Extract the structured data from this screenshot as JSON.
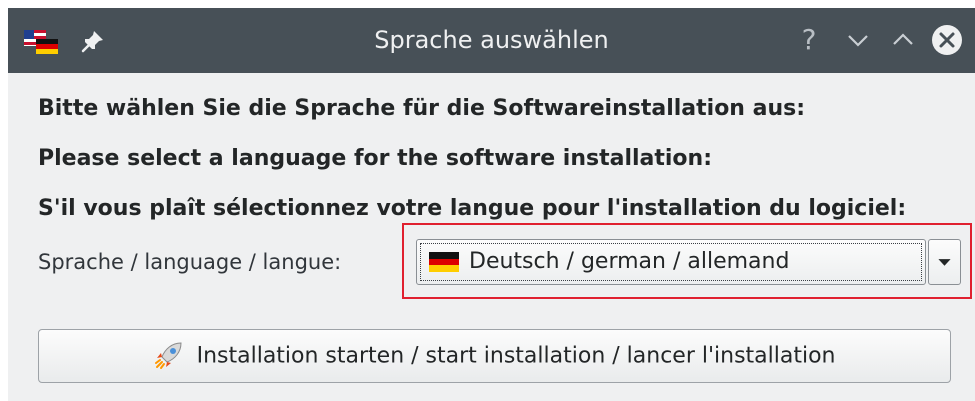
{
  "window": {
    "title": "Sprache auswählen",
    "help_glyph": "?",
    "icons": [
      "language-flags-icon",
      "pin-icon",
      "help-icon",
      "minimize-icon",
      "maximize-icon",
      "close-icon"
    ]
  },
  "prompt": {
    "de": "Bitte wählen Sie die Sprache für die Softwareinstallation aus:",
    "en": "Please select a language for the software installation:",
    "fr": "S'il vous plaît sélectionnez votre langue pour l'installation du logiciel:"
  },
  "language_select": {
    "label": "Sprache / language / langue:",
    "selected": "Deutsch / german / allemand",
    "selected_flag": "german-flag-icon"
  },
  "start_button": {
    "label": "Installation starten / start installation / lancer l'installation",
    "icon": "rocket-icon"
  },
  "colors": {
    "titlebar": "#475057",
    "window_bg": "#eff0f1",
    "highlight_border": "#e0202f"
  }
}
